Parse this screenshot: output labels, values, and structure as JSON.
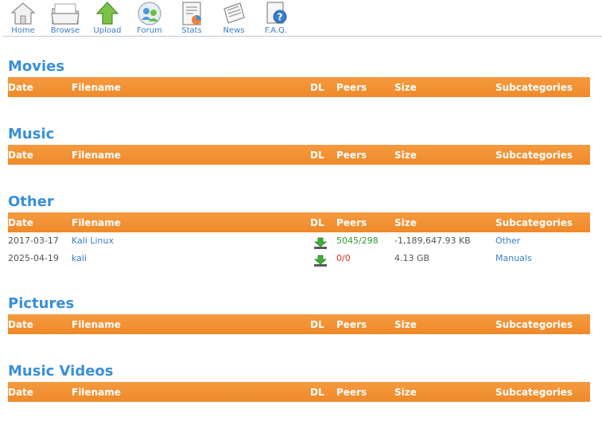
{
  "nav": [
    {
      "label": "Home",
      "icon": "home-icon"
    },
    {
      "label": "Browse",
      "icon": "browse-icon"
    },
    {
      "label": "Upload",
      "icon": "upload-icon"
    },
    {
      "label": "Forum",
      "icon": "forum-icon"
    },
    {
      "label": "Stats",
      "icon": "stats-icon"
    },
    {
      "label": "News",
      "icon": "news-icon"
    },
    {
      "label": "F.A.Q.",
      "icon": "faq-icon"
    }
  ],
  "columns": {
    "date": "Date",
    "filename": "Filename",
    "dl": "DL",
    "peers": "Peers",
    "size": "Size",
    "subcategories": "Subcategories"
  },
  "colors": {
    "header_bg": "#f0902f",
    "title": "#3a8fd8",
    "link": "#3a7ec7",
    "peers_active": "#2e9a2e",
    "peers_dead": "#e03020"
  },
  "categories": [
    {
      "title": "Movies",
      "rows": []
    },
    {
      "title": "Music",
      "rows": []
    },
    {
      "title": "Other",
      "rows": [
        {
          "date": "2017-03-17",
          "filename": "Kali Linux",
          "peers": "5045/298",
          "size": "-1,189,647.93 KB",
          "subcategory": "Other",
          "peers_status": "active"
        },
        {
          "date": "2025-04-19",
          "filename": "kali",
          "peers": "0/0",
          "size": "4.13 GB",
          "subcategory": "Manuals",
          "peers_status": "dead"
        }
      ]
    },
    {
      "title": "Pictures",
      "rows": []
    },
    {
      "title": "Music Videos",
      "rows": []
    }
  ]
}
